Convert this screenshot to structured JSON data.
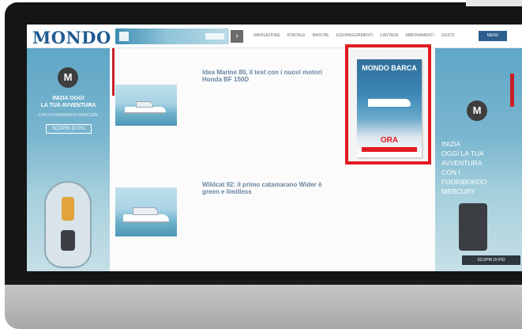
{
  "header": {
    "logo": "MONDO BARCA",
    "banner_text": "",
    "nav_items": [
      "NAVIGAZIONE",
      "PORTALE",
      "BARCHE",
      "EQUIPAGGIAMENTI",
      "CANTIERI",
      "ABBONAMENTI",
      "GIOCO"
    ],
    "nav_button": "MENU"
  },
  "left_ad": {
    "logo_letter": "M",
    "headline_line1": "INIZIA OGGI",
    "headline_line2": "LA TUA AVVENTURA",
    "subtitle": "CON I FUORIBORDO MERCURY",
    "cta": "SCOPRI DI PIÙ"
  },
  "right_ad": {
    "logo_letter": "M",
    "lines": [
      "INIZIA",
      "OGGI LA TUA",
      "AVVENTURA",
      "CON I",
      "FUORIBORDO",
      "MERCURY"
    ],
    "cta": "SCOPRI DI PIÙ"
  },
  "articles": [
    {
      "date": "",
      "title": "Idea Marine 80, il test con i nuovi motori Honda BF 150D",
      "text": "",
      "more": ""
    },
    {
      "date": "",
      "title": "Wildcat 92: il primo catamarano Wider è green e limitless",
      "text": "",
      "more": ""
    }
  ],
  "magazine": {
    "title": "MONDO BARCA",
    "ora": "ORA"
  },
  "sidebar_list": [],
  "colors": {
    "brand_blue": "#215c93",
    "accent_red": "#e11b22",
    "bezel": "#151515"
  }
}
